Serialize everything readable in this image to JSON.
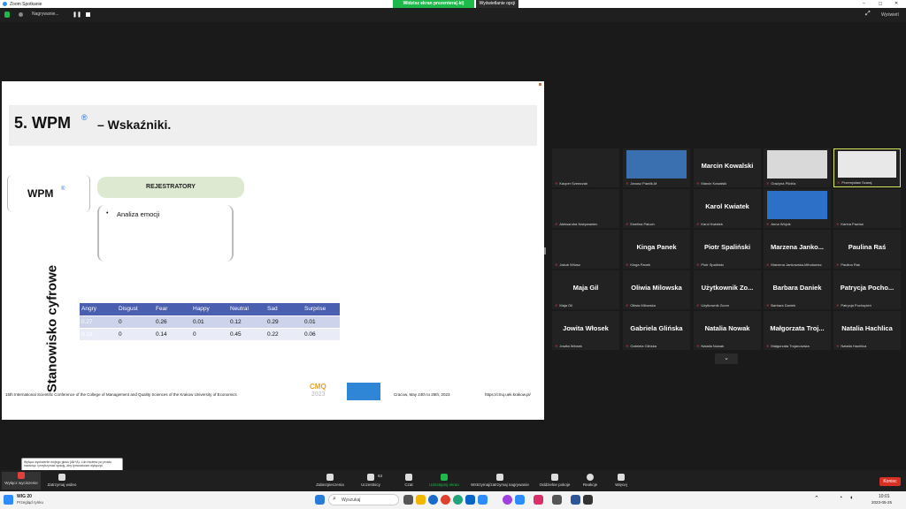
{
  "window": {
    "title": "Zoom Spotkanie",
    "controls": [
      "–",
      "◻",
      "✕"
    ]
  },
  "banner": {
    "viewing": "Widzisz ekran prezentera(-ki)",
    "options": "Wyświetlanie opcji"
  },
  "recording": {
    "label": "Nagrywanie..."
  },
  "topright": {
    "exit_label": "Wyświetl"
  },
  "slide": {
    "title_num": "5. WPM",
    "title_rest": "– Wskaźniki.",
    "wpm_box": "WPM",
    "pill": "REJESTRATORY",
    "bullet": "Analiza emocji",
    "vertical": "Stanowisko cyfrowe",
    "table": {
      "headers": [
        "Angry",
        "Disgust",
        "Fear",
        "Happy",
        "Neutral",
        "Sad",
        "Surprise"
      ],
      "rows": [
        [
          "0.27",
          "0",
          "0.26",
          "0.01",
          "0.12",
          "0.29",
          "0.01"
        ],
        [
          "0.18",
          "0",
          "0.14",
          "0",
          "0.45",
          "0.22",
          "0.06"
        ]
      ]
    },
    "footer_conf": "15th International Scientific Conference of the College of Management and Quality Sciences of the Krakow University of Economics",
    "footer_date": "Cracow,  May 24th to 25th, 2023",
    "footer_url": "https://cmq.uek.krakow.pl/",
    "logo_cmq": "CMQ",
    "logo_year": "2023"
  },
  "participants": [
    {
      "name": "",
      "label": "Kacper Szewczak"
    },
    {
      "name": "",
      "label": "Janusz Pawlik-M"
    },
    {
      "name": "Marcin Kowalski",
      "label": "Marcin Kowalski"
    },
    {
      "name": "",
      "label": "Grażyna Pilchla"
    },
    {
      "name": "",
      "label": "Przemysław Szaraj"
    },
    {
      "name": "",
      "label": "Aleksandra Nabywaniec"
    },
    {
      "name": "",
      "label": "Ewelina Paluch"
    },
    {
      "name": "Karol Kwiatek",
      "label": "Karol Kwiatek"
    },
    {
      "name": "",
      "label": "Anna Wójcik"
    },
    {
      "name": "",
      "label": "Karina Pawluś"
    },
    {
      "name": "",
      "label": "Jakub Wilusz"
    },
    {
      "name": "Kinga Panek",
      "label": "Kinga Panek"
    },
    {
      "name": "Piotr Spaliński",
      "label": "Piotr Spaliński"
    },
    {
      "name": "Marzena  Janko...",
      "label": "Marzena Jankowska-Mihułowicz"
    },
    {
      "name": "Paulina Raś",
      "label": "Paulina Raś"
    },
    {
      "name": "Maja Gil",
      "label": "Maja Gil"
    },
    {
      "name": "Oliwia Milowska",
      "label": "Oliwia Milowska"
    },
    {
      "name": "Użytkownik  Zo...",
      "label": "Użytkownik Zoom"
    },
    {
      "name": "Barbara Daniek",
      "label": "Barbara Daniek"
    },
    {
      "name": "Patrycja  Pocho...",
      "label": "Patrycja Pochopień"
    },
    {
      "name": "Jowita Włosek",
      "label": "Jowita Włosek"
    },
    {
      "name": "Gabriela Glińska",
      "label": "Gabriela Glińska"
    },
    {
      "name": "Natalia Nowak",
      "label": "Natalia Nowak"
    },
    {
      "name": "Małgorzata  Troj...",
      "label": "Małgorzata Trojanowska"
    },
    {
      "name": "Natalia Hachlica",
      "label": "Natalia Hachlica"
    }
  ],
  "tooltip": "Wyłącz wyciszenie mojego głosu (Alt+A). Lub możesz po prostu nacisnąć i przytrzymać spację, aby tymczasowo wyłączyć",
  "toolbar": {
    "mute": "Wyłącz wyciszenie",
    "video": "Zatrzymaj wideo",
    "security": "Zabezpieczenia",
    "participants": "Uczestnicy",
    "participants_count": "63",
    "chat": "Czat",
    "share": "Udostępnij ekran",
    "record": "Wstrzymaj/zatrzymaj nagrywanie",
    "rooms": "Oddzielne pokoje",
    "react": "Reakcje",
    "more": "Więcej",
    "end": "Koniec"
  },
  "taskbar": {
    "weather_temp": "WIG 20",
    "weather_sub": "Przegląd rynku",
    "search_placeholder": "Wyszukaj",
    "time": "10:01",
    "date": "2023-05-25"
  },
  "colors": {
    "share_green": "#1fb84a",
    "end_red": "#d93025",
    "table_blue": "#4a5fb0"
  }
}
